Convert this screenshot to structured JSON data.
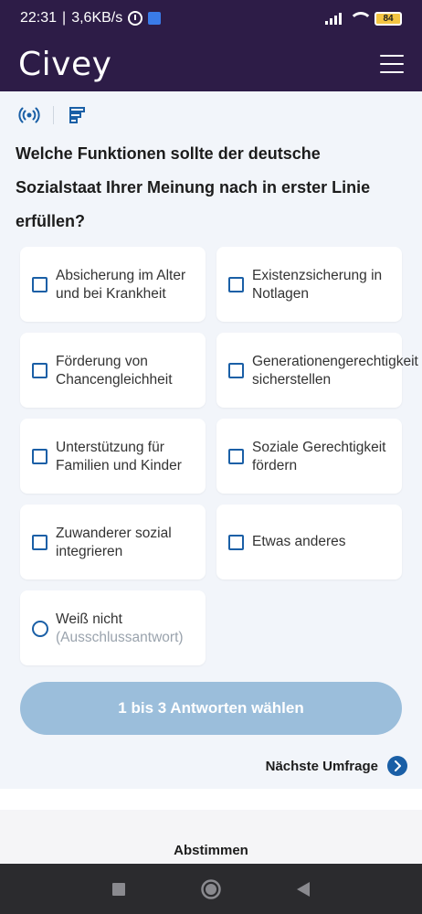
{
  "status_bar": {
    "time": "22:31",
    "speed": "3,6KB/s",
    "battery": "84"
  },
  "header": {
    "logo": "Civey"
  },
  "question": {
    "text": "Welche Funktionen sollte der deutsche Sozialstaat Ihrer Meinung nach in erster Linie erfüllen?"
  },
  "options": [
    {
      "label": "Absicherung im Alter und bei Krankheit"
    },
    {
      "label": "Existenzsicherung in Notlagen"
    },
    {
      "label": "Förderung von Chancengleichheit"
    },
    {
      "label": "Generationengerechtigkeit sicherstellen"
    },
    {
      "label": "Unterstützung für Familien und Kinder"
    },
    {
      "label": "Soziale Gerechtigkeit fördern"
    },
    {
      "label": "Zuwanderer sozial integrieren"
    },
    {
      "label": "Etwas anderes"
    },
    {
      "label": "Weiß nicht",
      "sublabel": "(Ausschlussantwort)"
    }
  ],
  "submit_label": "1 bis 3 Antworten wählen",
  "next_survey_label": "Nächste Umfrage",
  "bottom_tab_label": "Abstimmen",
  "colors": {
    "brand_purple": "#2d1c47",
    "accent_blue": "#1a5fa6",
    "button_disabled": "#9bbedb"
  },
  "icons": {
    "toolbar": [
      "broadcast-icon",
      "bar-chart-icon"
    ],
    "nav": [
      "recents-icon",
      "home-icon",
      "back-icon"
    ]
  }
}
